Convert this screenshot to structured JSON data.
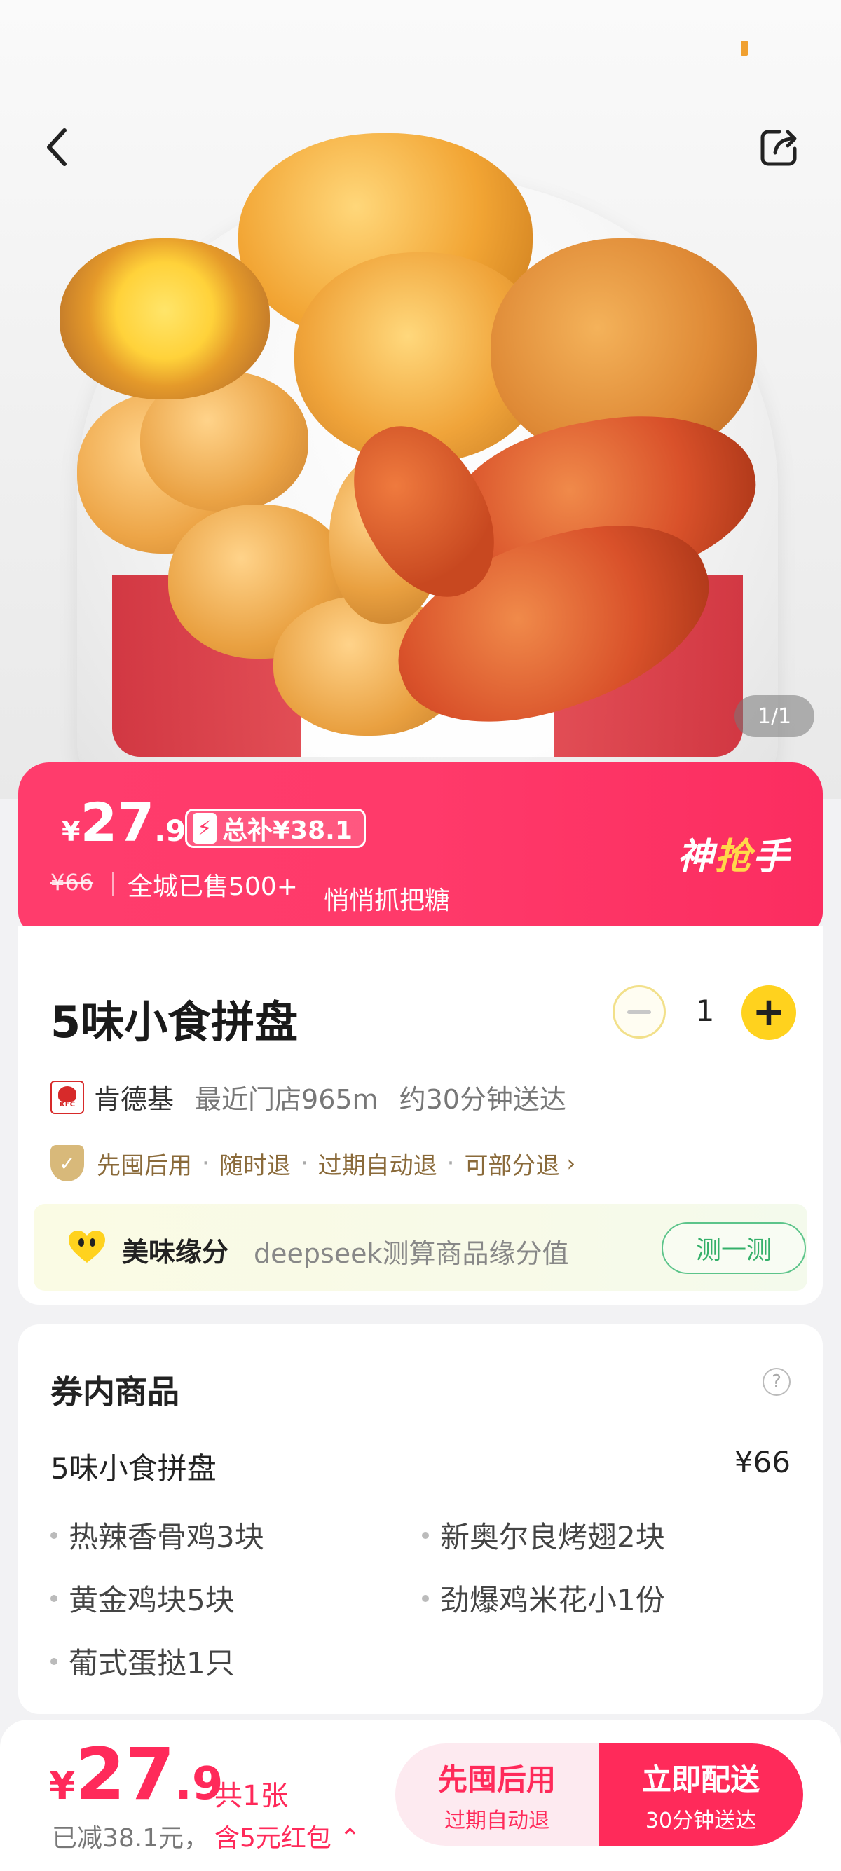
{
  "hero": {
    "image_desc_icon": "fried-chicken-bucket-photo",
    "pager": "1/1"
  },
  "nav": {
    "back_icon": "chevron-left-icon",
    "share_icon": "share-icon"
  },
  "price_banner": {
    "yen": "¥",
    "price_int": "27",
    "price_dec": ".9",
    "subsidy": "总补¥38.1",
    "original": "¥66",
    "sold": "全城已售500+",
    "hint": "悄悄抓把糖",
    "badge_a": "神",
    "badge_b": "抢",
    "badge_c": "手",
    "colors": {
      "banner": "#ff3a6a",
      "badge_accent": "#ffd84a"
    }
  },
  "product": {
    "title": "5味小食拼盘",
    "quantity": "1",
    "store_logo_text": "KFC",
    "store": "肯德基",
    "distance": "最近门店965m",
    "delivery": "约30分钟送达",
    "policies": [
      "先囤后用",
      "随时退",
      "过期自动退",
      "可部分退"
    ],
    "policy_sep": "·",
    "policy_chevron": "›",
    "fate_title": "美味缘分",
    "fate_desc": "deepseek测算商品缘分值",
    "fate_button": "测一测"
  },
  "voucher": {
    "title": "券内商品",
    "help": "?",
    "item_name": "5味小食拼盘",
    "item_price": "¥66",
    "sub_items": [
      "热辣香骨鸡3块",
      "新奥尔良烤翅2块",
      "黄金鸡块5块",
      "劲爆鸡米花小1份",
      "葡式蛋挞1只"
    ]
  },
  "bottom_bar": {
    "yen": "¥",
    "price_int": "27",
    "price_dec": ".9",
    "count": "共1张",
    "saved": "已减38.1元，",
    "red_packet": "含5元红包 ⌃",
    "left_btn_main": "先囤后用",
    "left_btn_sub": "过期自动退",
    "right_btn_main": "立即配送",
    "right_btn_sub": "30分钟送达",
    "colors": {
      "accent": "#ff2a5a"
    }
  }
}
